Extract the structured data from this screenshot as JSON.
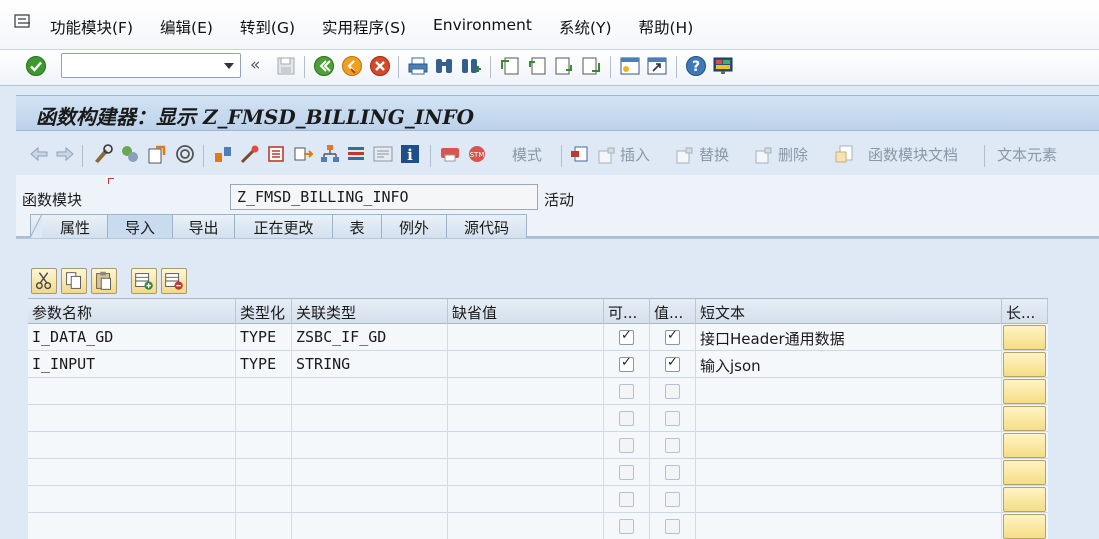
{
  "menubar": {
    "items": [
      "功能模块(F)",
      "编辑(E)",
      "转到(G)",
      "实用程序(S)",
      "Environment",
      "系统(Y)",
      "帮助(H)"
    ]
  },
  "toolbar": {
    "command_field_value": ""
  },
  "title": "函数构建器：显示 Z_FMSD_BILLING_INFO",
  "app_toolbar": {
    "pattern_label": "模式",
    "insert_label": "插入",
    "replace_label": "替换",
    "delete_label": "删除",
    "doc_label": "函数模块文档",
    "text_elements_label": "文本元素"
  },
  "header": {
    "fm_label": "函数模块",
    "fm_name": "Z_FMSD_BILLING_INFO",
    "status": "活动"
  },
  "tabs": [
    "属性",
    "导入",
    "导出",
    "正在更改",
    "表",
    "例外",
    "源代码"
  ],
  "active_tab": "导入",
  "grid": {
    "columns": [
      "参数名称",
      "类型化",
      "关联类型",
      "缺省值",
      "可...",
      "值...",
      "短文本",
      "长..."
    ],
    "rows": [
      {
        "name": "I_DATA_GD",
        "typing": "TYPE",
        "assoc_type": "ZSBC_IF_GD",
        "default": "",
        "optional": true,
        "pass_value": true,
        "short_text": "接口Header通用数据"
      },
      {
        "name": "I_INPUT",
        "typing": "TYPE",
        "assoc_type": "STRING",
        "default": "",
        "optional": true,
        "pass_value": true,
        "short_text": "输入json"
      },
      {
        "name": "",
        "typing": "",
        "assoc_type": "",
        "default": "",
        "optional": false,
        "pass_value": false,
        "short_text": ""
      },
      {
        "name": "",
        "typing": "",
        "assoc_type": "",
        "default": "",
        "optional": false,
        "pass_value": false,
        "short_text": ""
      },
      {
        "name": "",
        "typing": "",
        "assoc_type": "",
        "default": "",
        "optional": false,
        "pass_value": false,
        "short_text": ""
      },
      {
        "name": "",
        "typing": "",
        "assoc_type": "",
        "default": "",
        "optional": false,
        "pass_value": false,
        "short_text": ""
      },
      {
        "name": "",
        "typing": "",
        "assoc_type": "",
        "default": "",
        "optional": false,
        "pass_value": false,
        "short_text": ""
      },
      {
        "name": "",
        "typing": "",
        "assoc_type": "",
        "default": "",
        "optional": false,
        "pass_value": false,
        "short_text": ""
      }
    ]
  },
  "colors": {
    "background": "#dfe9f5",
    "title_bar": "#c8daee",
    "enter_green": "#3c9a2e",
    "cancel_red": "#d24a2a",
    "long_text_button": "#f5de86"
  }
}
